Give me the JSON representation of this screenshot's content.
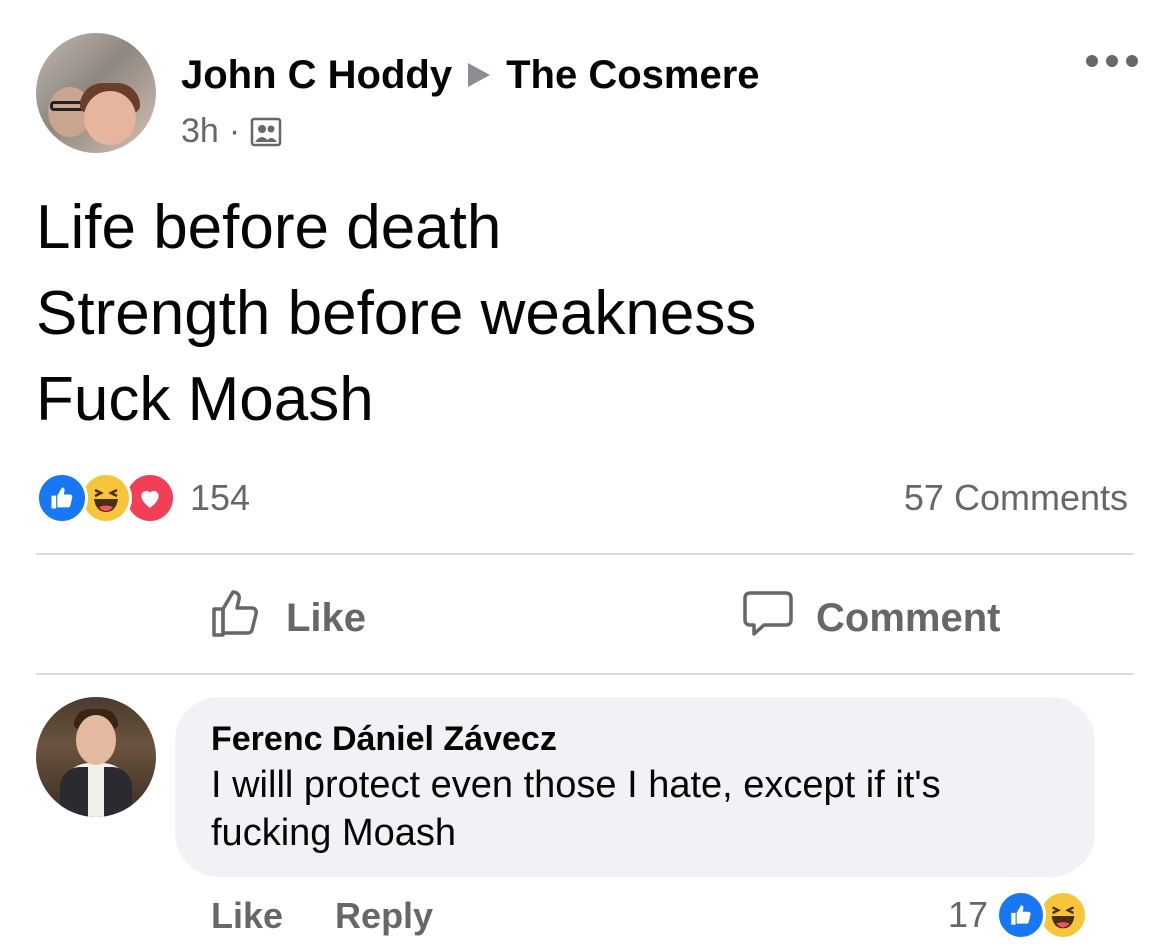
{
  "post": {
    "author": "John C Hoddy",
    "group": "The Cosmere",
    "time": "3h",
    "dot": "·",
    "text_lines": [
      "Life before death",
      "Strength before weakness",
      "Fuck Moash"
    ],
    "reaction_count": "154",
    "comment_count": "57 Comments",
    "reaction_icons": [
      "like-icon",
      "haha-icon",
      "love-icon"
    ]
  },
  "actions": {
    "like": "Like",
    "comment": "Comment"
  },
  "comment": {
    "author": "Ferenc Dániel Závecz",
    "text": "I willl protect even those I hate, except if it's fucking Moash",
    "like": "Like",
    "reply": "Reply",
    "reaction_count": "17",
    "reaction_icons": [
      "like-icon",
      "haha-icon"
    ]
  },
  "colors": {
    "like_blue": "#1877f2",
    "haha_yellow": "#f7c53a",
    "love_red": "#f33e58",
    "secondary_text": "#65676b",
    "bubble_bg": "#f0f2f5"
  }
}
